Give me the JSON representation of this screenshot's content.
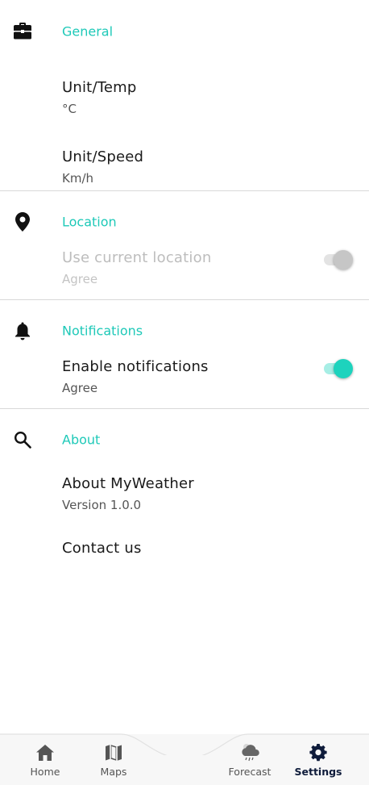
{
  "sections": {
    "general": {
      "title": "General",
      "icon": "briefcase-icon",
      "items": [
        {
          "title": "Unit/Temp",
          "value": "°C"
        },
        {
          "title": "Unit/Speed",
          "value": "Km/h"
        }
      ]
    },
    "location": {
      "title": "Location",
      "icon": "location-pin-icon",
      "item": {
        "title": "Use current location",
        "value": "Agree",
        "enabled": false,
        "toggle_on": false
      }
    },
    "notifications": {
      "title": "Notifications",
      "icon": "bell-icon",
      "item": {
        "title": "Enable notifications",
        "value": "Agree",
        "toggle_on": true
      }
    },
    "about": {
      "title": "About",
      "icon": "search-icon",
      "items": [
        {
          "title": "About MyWeather",
          "value": "Version 1.0.0"
        },
        {
          "title": "Contact us"
        }
      ]
    }
  },
  "bottom_nav": {
    "items": [
      {
        "label": "Home",
        "icon": "home-icon"
      },
      {
        "label": "Maps",
        "icon": "map-icon"
      },
      {
        "label": "Forecast",
        "icon": "rain-cloud-icon"
      },
      {
        "label": "Settings",
        "icon": "gear-icon",
        "active": true
      }
    ]
  },
  "colors": {
    "accent": "#1ec9b8",
    "toggle_on": "#1dd3bd",
    "active_nav": "#0f1c3b",
    "divider": "#d8d8d8"
  }
}
